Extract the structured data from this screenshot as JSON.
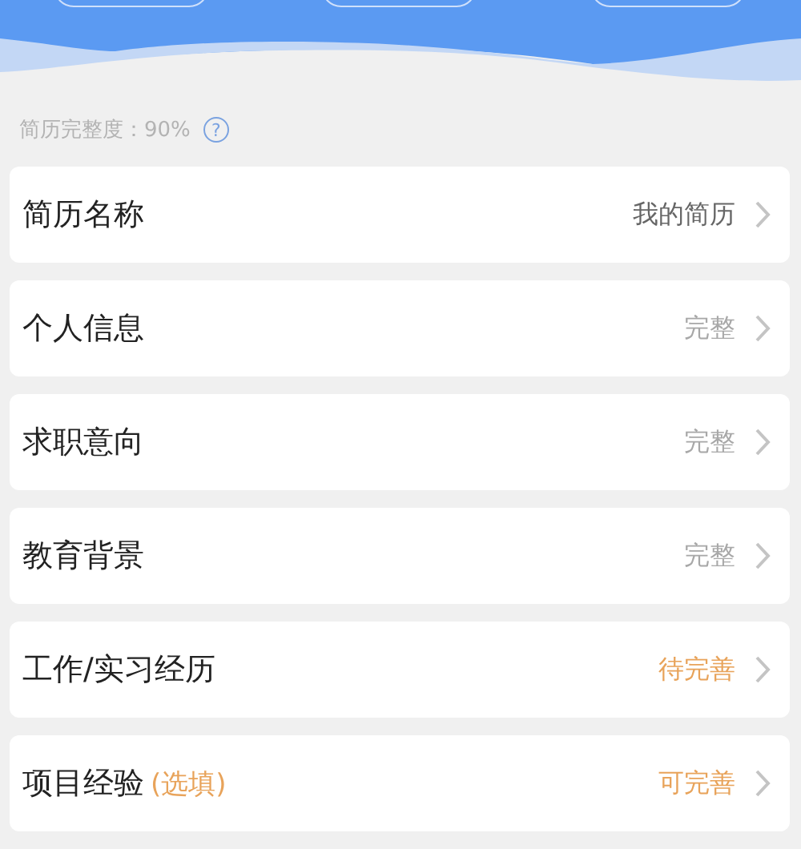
{
  "completeness": {
    "label": "简历完整度：90%",
    "help_icon": "?"
  },
  "sections": [
    {
      "title": "简历名称",
      "status": "我的简历",
      "kind": "value"
    },
    {
      "title": "个人信息",
      "status": "完整",
      "kind": "complete"
    },
    {
      "title": "求职意向",
      "status": "完整",
      "kind": "complete"
    },
    {
      "title": "教育背景",
      "status": "完整",
      "kind": "complete"
    },
    {
      "title": "工作/实习经历",
      "status": "待完善",
      "kind": "pending"
    },
    {
      "title": "项目经验",
      "tag": "(选填)",
      "status": "可完善",
      "kind": "pending"
    }
  ]
}
